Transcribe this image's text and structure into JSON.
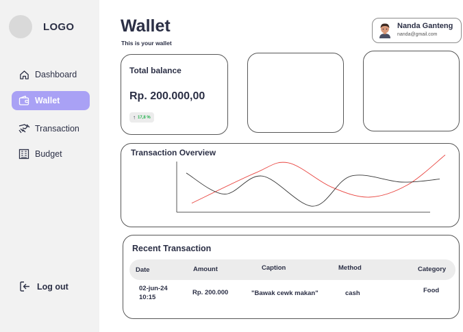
{
  "sidebar": {
    "logo": "LOGO",
    "items": [
      {
        "label": "Dashboard",
        "icon": "home-icon",
        "active": false
      },
      {
        "label": "Wallet",
        "icon": "wallet-icon",
        "active": true
      },
      {
        "label": "Transaction",
        "icon": "transaction-icon",
        "active": false
      },
      {
        "label": "Budget",
        "icon": "budget-icon",
        "active": false
      }
    ],
    "logout": "Log out"
  },
  "header": {
    "title": "Wallet",
    "subtitle": "This is your wallet"
  },
  "profile": {
    "name": "Nanda Ganteng",
    "email": "nanda@gmail.com"
  },
  "balance": {
    "label": "Total balance",
    "value": "Rp. 200.000,00",
    "change": "17,8 %"
  },
  "chart": {
    "title": "Transaction Overview"
  },
  "chart_data": {
    "type": "line",
    "title": "Transaction Overview",
    "xlabel": "",
    "ylabel": "",
    "grid": false,
    "legend": "none",
    "series": [
      {
        "color": "#e8413c",
        "values": [
          [
            0,
            0.15
          ],
          [
            0.25,
            0.65
          ],
          [
            0.38,
            0.82
          ],
          [
            0.55,
            0.42
          ],
          [
            0.7,
            0.25
          ],
          [
            0.85,
            0.45
          ],
          [
            1.0,
            0.95
          ]
        ]
      },
      {
        "color": "#333333",
        "values": [
          [
            0,
            0.65
          ],
          [
            0.15,
            0.3
          ],
          [
            0.3,
            0.6
          ],
          [
            0.5,
            0.1
          ],
          [
            0.65,
            0.6
          ],
          [
            0.85,
            0.5
          ],
          [
            1.0,
            0.55
          ]
        ]
      }
    ]
  },
  "transactions": {
    "title": "Recent Transaction",
    "columns": [
      "Date",
      "Amount",
      "Caption",
      "Method",
      "Category"
    ],
    "rows": [
      {
        "date1": "02-jun-24",
        "date2": "10:15",
        "amount": "Rp. 200.000",
        "caption": "\"Bawak cewk makan\"",
        "method": "cash",
        "category": "Food"
      }
    ]
  },
  "colors": {
    "accent": "#a9a1f5",
    "sidebar_bg": "#f2f2f2",
    "positive": "#22b14c",
    "chart_red": "#e8413c",
    "text": "#2b2f45"
  }
}
